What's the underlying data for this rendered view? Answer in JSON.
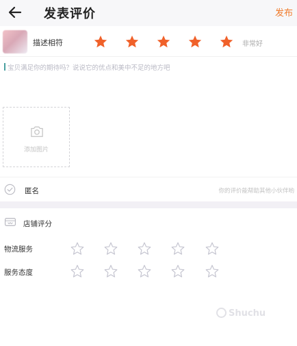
{
  "header": {
    "title": "发表评价",
    "publish_label": "发布"
  },
  "product_rating": {
    "label": "描述相符",
    "stars_filled": 5,
    "stars_total": 5,
    "rating_text": "非常好",
    "star_color": "#f0612a"
  },
  "review": {
    "placeholder": "宝贝满足你的期待吗？说说它的优点和美中不足的地方吧"
  },
  "photo": {
    "label": "添加图片"
  },
  "anonymous": {
    "label": "匿名",
    "hint": "你的评价能帮助其他小伙伴哟"
  },
  "shop_rating": {
    "title": "店铺评分",
    "metrics": [
      {
        "label": "物流服务",
        "stars_filled": 0,
        "stars_total": 5
      },
      {
        "label": "服务态度",
        "stars_filled": 0,
        "stars_total": 5
      }
    ]
  },
  "watermark": {
    "text": "Shuchu"
  },
  "colors": {
    "accent": "#f07a2a",
    "star_empty": "#c5c5d0"
  }
}
